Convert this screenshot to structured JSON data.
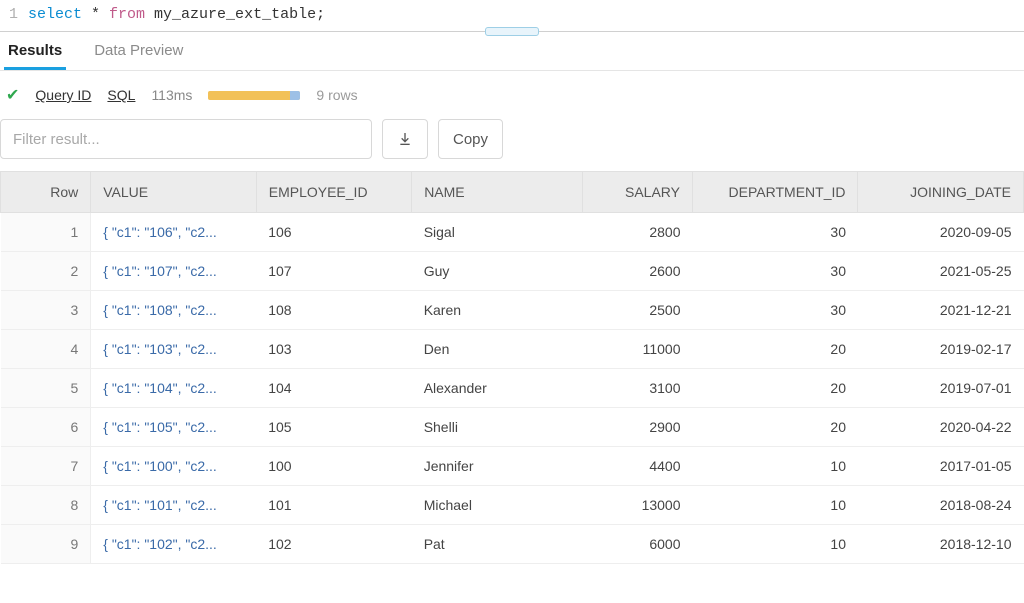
{
  "editor": {
    "line_number": "1",
    "kw_select": "select",
    "star": " * ",
    "kw_from": "from",
    "rest": " my_azure_ext_table;"
  },
  "tabs": {
    "results": "Results",
    "data_preview": "Data Preview"
  },
  "status": {
    "query_id_label": "Query ID",
    "sql_label": "SQL",
    "duration": "113ms",
    "rows_label": "9 rows"
  },
  "controls": {
    "filter_placeholder": "Filter result...",
    "copy_label": "Copy"
  },
  "table": {
    "headers": {
      "row": "Row",
      "value": "VALUE",
      "employee_id": "EMPLOYEE_ID",
      "name": "NAME",
      "salary": "SALARY",
      "department_id": "DEPARTMENT_ID",
      "joining_date": "JOINING_DATE"
    },
    "rows": [
      {
        "n": "1",
        "value": "{ \"c1\": \"106\", \"c2...",
        "emp": "106",
        "name": "Sigal",
        "salary": "2800",
        "dept": "30",
        "date": "2020-09-05"
      },
      {
        "n": "2",
        "value": "{ \"c1\": \"107\", \"c2...",
        "emp": "107",
        "name": "Guy",
        "salary": "2600",
        "dept": "30",
        "date": "2021-05-25"
      },
      {
        "n": "3",
        "value": "{ \"c1\": \"108\", \"c2...",
        "emp": "108",
        "name": "Karen",
        "salary": "2500",
        "dept": "30",
        "date": "2021-12-21"
      },
      {
        "n": "4",
        "value": "{ \"c1\": \"103\", \"c2...",
        "emp": "103",
        "name": "Den",
        "salary": "11000",
        "dept": "20",
        "date": "2019-02-17"
      },
      {
        "n": "5",
        "value": "{ \"c1\": \"104\", \"c2...",
        "emp": "104",
        "name": "Alexander",
        "salary": "3100",
        "dept": "20",
        "date": "2019-07-01"
      },
      {
        "n": "6",
        "value": "{ \"c1\": \"105\", \"c2...",
        "emp": "105",
        "name": "Shelli",
        "salary": "2900",
        "dept": "20",
        "date": "2020-04-22"
      },
      {
        "n": "7",
        "value": "{ \"c1\": \"100\", \"c2...",
        "emp": "100",
        "name": "Jennifer",
        "salary": "4400",
        "dept": "10",
        "date": "2017-01-05"
      },
      {
        "n": "8",
        "value": "{ \"c1\": \"101\", \"c2...",
        "emp": "101",
        "name": "Michael",
        "salary": "13000",
        "dept": "10",
        "date": "2018-08-24"
      },
      {
        "n": "9",
        "value": "{ \"c1\": \"102\", \"c2...",
        "emp": "102",
        "name": "Pat",
        "salary": "6000",
        "dept": "10",
        "date": "2018-12-10"
      }
    ]
  }
}
